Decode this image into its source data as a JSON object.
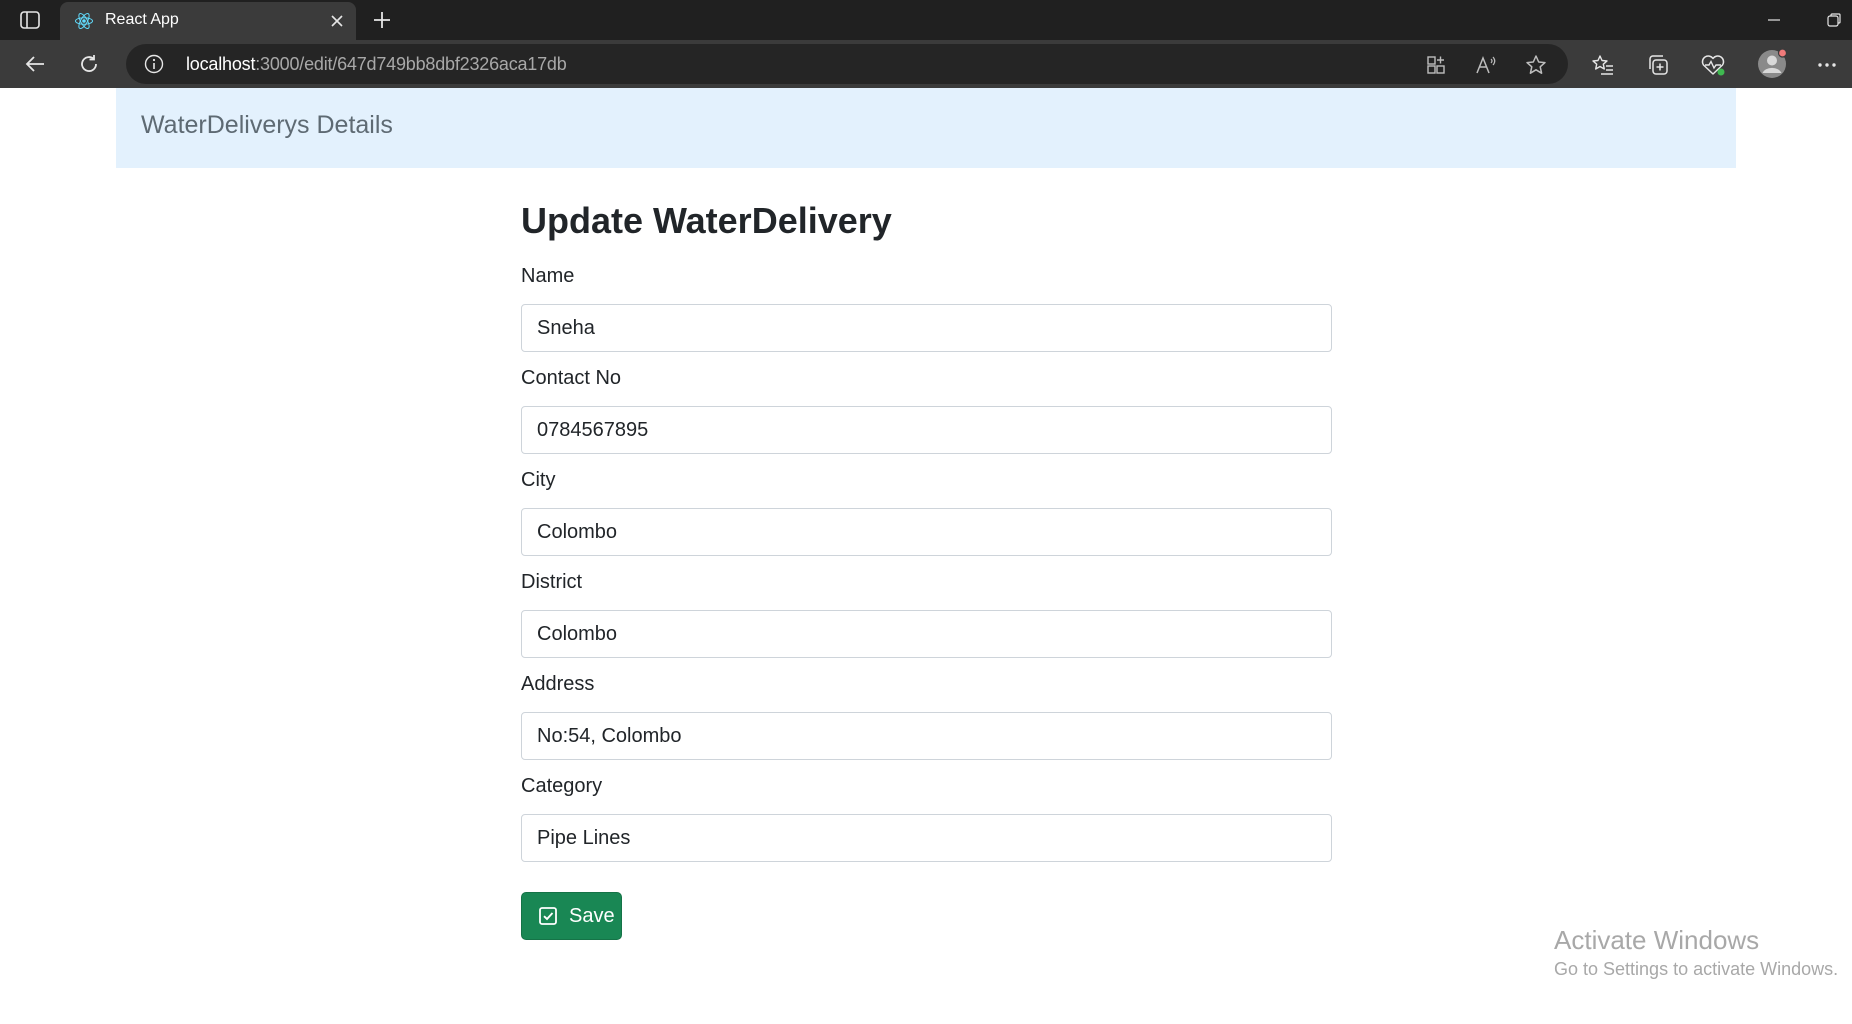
{
  "browser": {
    "tab_title": "React App",
    "url_host": "localhost",
    "url_path": ":3000/edit/647d749bb8dbf2326aca17db"
  },
  "navbar": {
    "brand": "WaterDeliverys Details"
  },
  "form": {
    "title": "Update WaterDelivery",
    "fields": [
      {
        "label": "Name",
        "value": "Sneha"
      },
      {
        "label": "Contact No",
        "value": "0784567895"
      },
      {
        "label": "City",
        "value": "Colombo"
      },
      {
        "label": "District",
        "value": "Colombo"
      },
      {
        "label": "Address",
        "value": "No:54, Colombo"
      },
      {
        "label": "Category",
        "value": "Pipe Lines"
      }
    ],
    "save_label": "Save"
  },
  "watermark": {
    "title": "Activate Windows",
    "subtitle": "Go to Settings to activate Windows."
  },
  "colors": {
    "navbar_bg": "#e3f1fd",
    "save_button": "#198754",
    "title_text": "#212529"
  }
}
